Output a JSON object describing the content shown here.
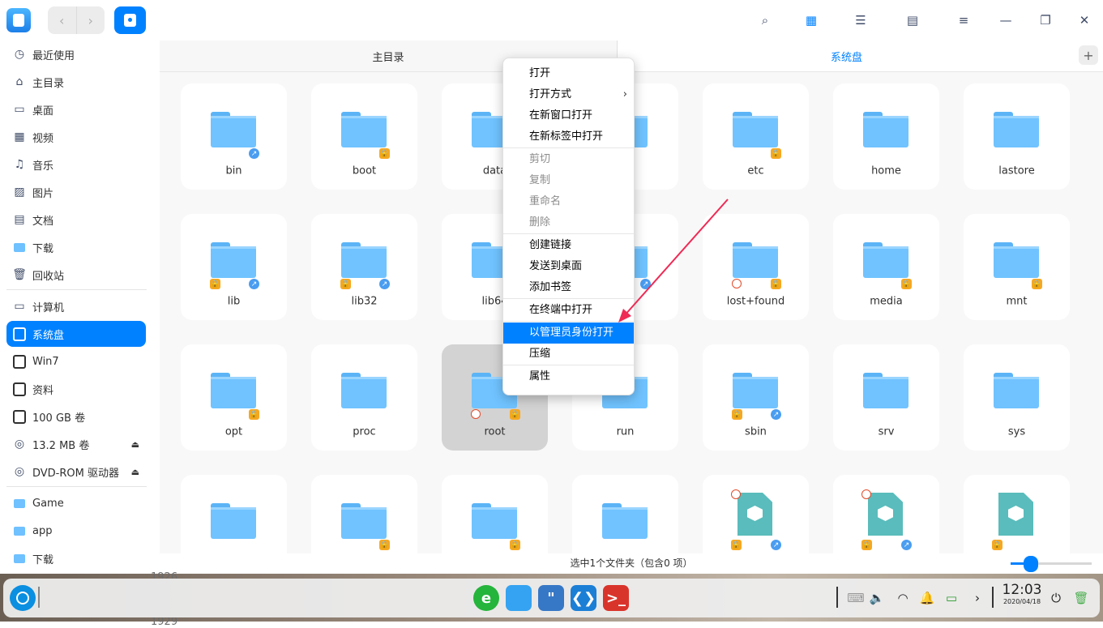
{
  "toolbar": {
    "back_icon": "‹",
    "forward_icon": "›",
    "search_icon": "⌕",
    "icon_view_icon": "▦",
    "list_view_icon": "☰",
    "detail_view_icon": "▤",
    "menu_icon": "≡",
    "minimize_icon": "—",
    "maximize_icon": "❐",
    "close_icon": "✕"
  },
  "sidebar": {
    "items": [
      {
        "label": "最近使用",
        "icon": "◷"
      },
      {
        "label": "主目录",
        "icon": "⌂"
      },
      {
        "label": "桌面",
        "icon": "▭"
      },
      {
        "label": "视频",
        "icon": "▦"
      },
      {
        "label": "音乐",
        "icon": "♫"
      },
      {
        "label": "图片",
        "icon": "▨"
      },
      {
        "label": "文档",
        "icon": "▤"
      },
      {
        "label": "下载",
        "icon": "folder"
      },
      {
        "label": "回收站",
        "icon": "🗑"
      },
      {
        "label": "计算机",
        "icon": "▭"
      },
      {
        "label": "系统盘",
        "icon": "disk"
      },
      {
        "label": "Win7",
        "icon": "disk"
      },
      {
        "label": "资料",
        "icon": "disk"
      },
      {
        "label": "100 GB 卷",
        "icon": "disk"
      },
      {
        "label": "13.2 MB 卷",
        "icon": "◎"
      },
      {
        "label": "DVD-ROM 驱动器",
        "icon": "◎"
      },
      {
        "label": "Game",
        "icon": "folder"
      },
      {
        "label": "app",
        "icon": "folder"
      },
      {
        "label": "下载",
        "icon": "folder"
      }
    ],
    "eject_icon": "⏏"
  },
  "tabs": {
    "tab1": "主目录",
    "tab2": "系统盘",
    "add_icon": "+"
  },
  "files": [
    {
      "name": "bin",
      "badges": [
        "link"
      ]
    },
    {
      "name": "boot",
      "badges": [
        "lock"
      ]
    },
    {
      "name": "data",
      "badges": []
    },
    {
      "name": "",
      "badges": []
    },
    {
      "name": "etc",
      "badges": [
        "lock"
      ]
    },
    {
      "name": "home",
      "badges": []
    },
    {
      "name": "lastore",
      "badges": []
    },
    {
      "name": "lib",
      "badges": [
        "lock",
        "link"
      ]
    },
    {
      "name": "lib32",
      "badges": [
        "lock",
        "link"
      ]
    },
    {
      "name": "lib64",
      "badges": [
        "lock"
      ]
    },
    {
      "name": "2",
      "badges": [
        "link"
      ]
    },
    {
      "name": "lost+found",
      "badges": [
        "no",
        "lock"
      ]
    },
    {
      "name": "media",
      "badges": [
        "lock"
      ]
    },
    {
      "name": "mnt",
      "badges": [
        "lock"
      ]
    },
    {
      "name": "opt",
      "badges": [
        "lock"
      ]
    },
    {
      "name": "proc",
      "badges": []
    },
    {
      "name": "root",
      "badges": [
        "no",
        "lock"
      ]
    },
    {
      "name": "run",
      "badges": []
    },
    {
      "name": "sbin",
      "badges": [
        "lock",
        "link"
      ]
    },
    {
      "name": "srv",
      "badges": []
    },
    {
      "name": "sys",
      "badges": []
    },
    {
      "name": "",
      "badges": []
    },
    {
      "name": "",
      "badges": [
        "lock"
      ]
    },
    {
      "name": "",
      "badges": [
        "lock"
      ]
    },
    {
      "name": "",
      "badges": []
    },
    {
      "name": "",
      "badges": [
        "no",
        "lock",
        "link"
      ],
      "type": "pkg"
    },
    {
      "name": "",
      "badges": [
        "no",
        "lock",
        "link"
      ],
      "type": "pkg"
    },
    {
      "name": "",
      "badges": [
        "lock"
      ],
      "type": "pkg"
    }
  ],
  "context_menu": {
    "items": [
      {
        "label": "打开",
        "state": "normal"
      },
      {
        "label": "打开方式",
        "state": "normal",
        "submenu": "›"
      },
      {
        "label": "在新窗口打开",
        "state": "normal"
      },
      {
        "label": "在新标签中打开",
        "state": "normal"
      },
      {
        "label": "剪切",
        "state": "disabled"
      },
      {
        "label": "复制",
        "state": "disabled"
      },
      {
        "label": "重命名",
        "state": "disabled"
      },
      {
        "label": "删除",
        "state": "disabled"
      },
      {
        "label": "创建链接",
        "state": "normal"
      },
      {
        "label": "发送到桌面",
        "state": "normal"
      },
      {
        "label": "添加书签",
        "state": "normal"
      },
      {
        "label": "在终端中打开",
        "state": "normal"
      },
      {
        "label": "以管理员身份打开",
        "state": "highlighted"
      },
      {
        "label": "压缩",
        "state": "normal"
      },
      {
        "label": "属性",
        "state": "normal"
      }
    ]
  },
  "status": {
    "text": "选中1个文件夹（包含0 项）",
    "zoom_level": 0.25
  },
  "desktop": {
    "line1": "1926",
    "line2": "1929"
  },
  "dock": {
    "apps": [
      {
        "name": "browser",
        "glyph": "e",
        "color": "#25b43c"
      },
      {
        "name": "file-manager",
        "glyph": "",
        "color": "#35a3f1"
      },
      {
        "name": "app-store",
        "glyph": "\"",
        "color": "#3778c6"
      },
      {
        "name": "vscode",
        "glyph": "❮❯",
        "color": "#1b7fd6"
      },
      {
        "name": "terminal",
        "glyph": ">_",
        "color": "#d9342b"
      }
    ],
    "clock_time": "12:03",
    "clock_date": "2020/04/18"
  },
  "colors": {
    "accent": "#0081ff",
    "arrow": "#ef2a55"
  }
}
